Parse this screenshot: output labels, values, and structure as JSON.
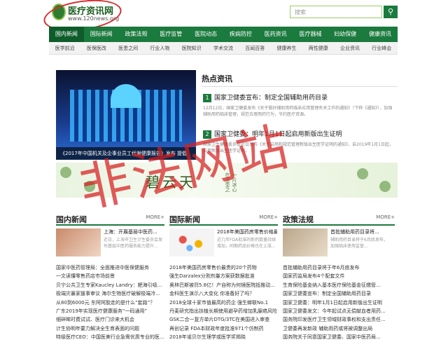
{
  "header": {
    "site_name": "医疗资讯网",
    "site_url": "www.120news.org",
    "search_placeholder": "搜索",
    "search_button_icon": "search-icon"
  },
  "main_nav": [
    "国内新闻",
    "国际新闻",
    "政策法规",
    "医疗监管",
    "医院动态",
    "疾病防控",
    "医药资讯",
    "医疗器械",
    "妇幼保健",
    "健康资讯"
  ],
  "sub_nav": [
    "医学前沿",
    "医保医改",
    "医患之间",
    "行业人物",
    "医院知识",
    "学术交流",
    "百闻百答",
    "健康养生",
    "两性健康",
    "企业资讯",
    "行业峰会"
  ],
  "hero": {
    "caption": "《2017年中国机关及企事业员工代谢健康报告》发布 提倡"
  },
  "hot_news": {
    "title": "热点资讯",
    "items": [
      {
        "num": "1",
        "headline": "国家卫健委宣布：制定全国辅助用药目录",
        "desc": "12月12日，国家卫健委发布《关于做好辅助用药临床应用管理有关工作的通知》（下称《通知》），加强辅助用药临床管理，规范合理用药行为，节约医疗资源。"
      },
      {
        "num": "2",
        "headline": "国家卫健委：明年1月1日起启用新版出生证明",
        "desc": "国家卫生健康委员会近日发布《关于启用和规范管理新版出生医学证明的通知》，自2019年1月1日起，启用新版出生医学证明。"
      }
    ]
  },
  "banner": {
    "text": "碧云天",
    "side_text": "一片冰心在玉壶之"
  },
  "columns": [
    {
      "title": "国内新闻",
      "more": "MORE+",
      "feature_title": "上海：开展基层中医药...",
      "feature_desc": "近日，上海市卫生计生委员会发布基层中医药服务能力提升...",
      "list": [
        "国家中医药管理局：全面推进中医保健服务",
        "一文读懂零售药店市场前景",
        "贝宁公共卫生专家Kaucley Landry：耙海引吸...",
        "极端灾暴家援事审议 海尔生物医疗破解极端冷...",
        "从80到6000元 东阿阿胶走的是什么“套路”？",
        "广东2019年实现医疗健康服务“一码通用”",
        "细碎眸时费试试、医疗门诊来大机会",
        "计生协明年要力解决全生育表面的问题",
        "特级医疗CEO：中国医美行业急需优质专业的医..."
      ]
    },
    {
      "title": "国际新闻",
      "more": "MORE+",
      "feature_title": "2018年美国药房零售价格最贵的20个药物",
      "feature_desc": "近几年FDA批准的新药数量持续增加，同期药品价格也在上涨...",
      "list": [
        "2018年美国药房零售价最贵的20个药物",
        "强生Darzalex分割剂量方案获数据批准",
        "奥林巴斯被罚5.8亿！产自称为何镜医院抵推动...",
        "金科医生演示八大变化 你准备好了吗？",
        "2018全球十家市值最高的药企 强生蝉联No.1",
        "丹麦研究指出扶植长期使用避孕药增加乳腺癌风险",
        "GSK二合一复方单片DTG/3TC在美国进入审查",
        "再创记录 FDA本财政年度批准971个仿制药",
        "2018年诺贝尔生理学或医学奖揭晓"
      ]
    },
    {
      "title": "政策法规",
      "more": "MORE+",
      "feature_title": "首批辅助用药目录将...",
      "feature_desc": "辅助用药目录将于6月底发布，加强临床使用监管...",
      "list": [
        "首批辅助用药目录将于年6月底发布",
        "国家药监局发布4个配套文件",
        "生育保险基金纳入基本医疗保险基金征缴管...",
        "国家卫健委宣布：制定全国辅助用药目录",
        "国家卫健委：明年1月1日起启用新版出生证明",
        "国家卫健委发文：今年起试点无偿献血者用药...",
        "国务院印发医疗卫生领域财政事权和支出责任...",
        "卫健委再发新政 辅助用药或将被调整出局",
        "国务院关于同意国家卫健委、国家中医药局..."
      ]
    }
  ],
  "watermark_stamp": "非法网站"
}
